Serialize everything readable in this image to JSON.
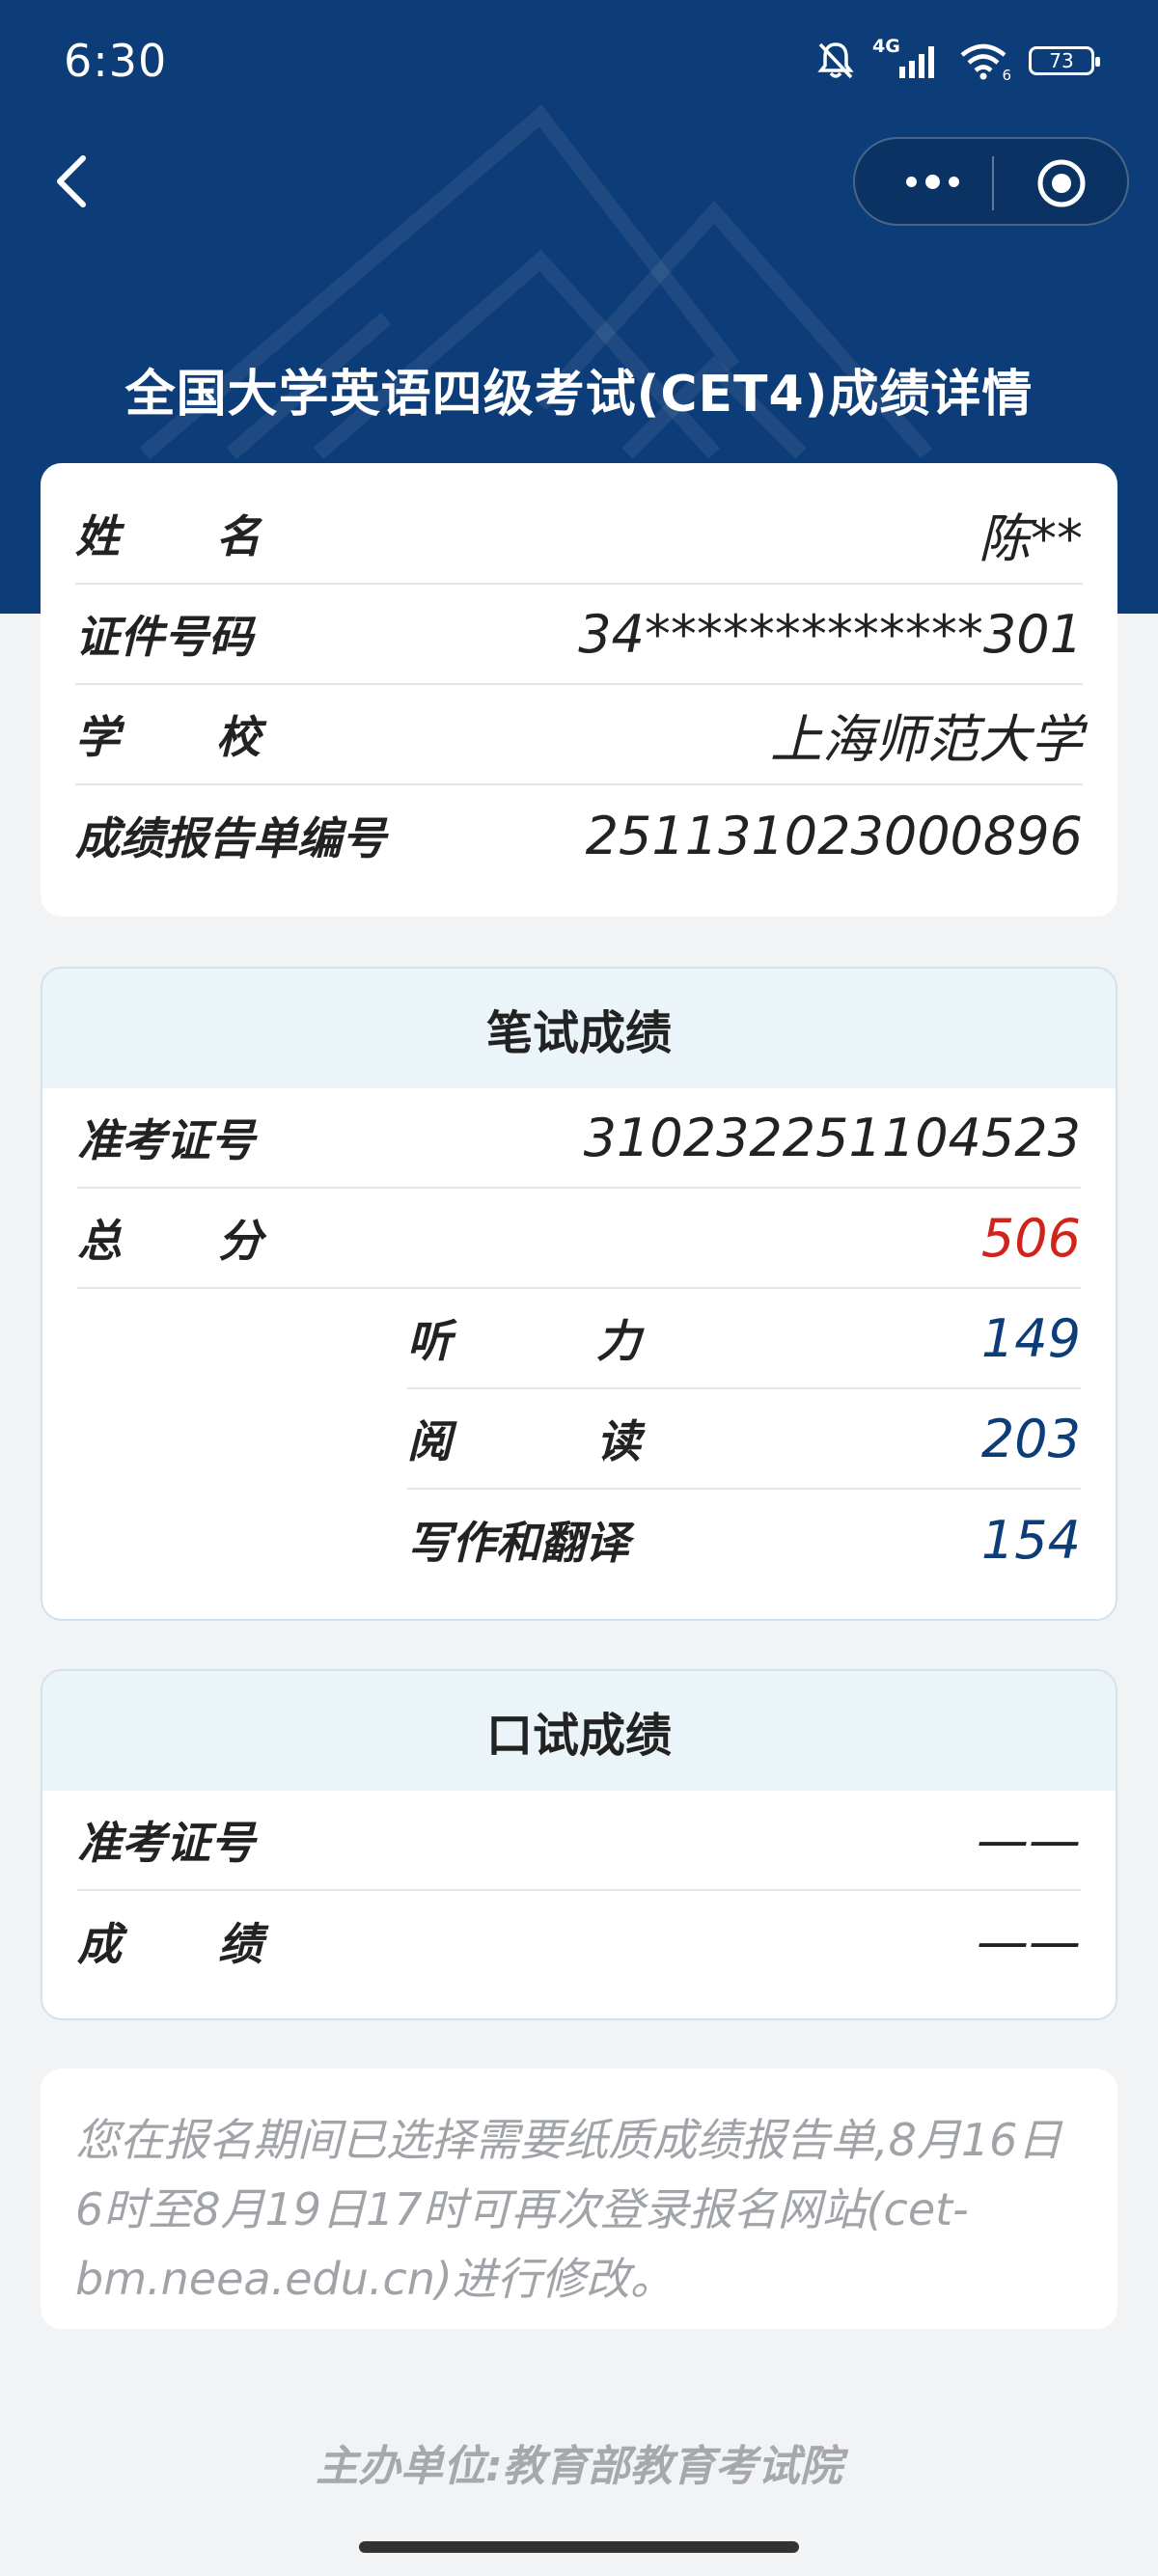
{
  "status_bar": {
    "time": "6:30",
    "network": "4G",
    "wifi_sub": "6",
    "battery": "73"
  },
  "header": {
    "title": "全国大学英语四级考试(CET4)成绩详情"
  },
  "personal_info": {
    "rows": [
      {
        "label": "姓名",
        "value": "陈**"
      },
      {
        "label": "证件号码",
        "value": "34*************301"
      },
      {
        "label": "学校",
        "value": "上海师范大学"
      },
      {
        "label": "成绩报告单编号",
        "value": "251131023000896"
      }
    ]
  },
  "written": {
    "title": "笔试成绩",
    "ticket_label": "准考证号",
    "ticket_value": "310232251104523",
    "total_label": "总分",
    "total_value": "506",
    "sections": [
      {
        "label": "听力",
        "value": "149"
      },
      {
        "label": "阅读",
        "value": "203"
      },
      {
        "label": "写作和翻译",
        "value": "154"
      }
    ]
  },
  "oral": {
    "title": "口试成绩",
    "ticket_label": "准考证号",
    "ticket_value": "——",
    "score_label": "成绩",
    "score_value": "——"
  },
  "notice": "您在报名期间已选择需要纸质成绩报告单,8月16日6时至8月19日17时可再次登录报名网站(cet-bm.neea.edu.cn)进行修改。",
  "footer": "主办单位:教育部教育考试院",
  "colors": {
    "header_bg": "#0d3d78",
    "total_score": "#d0231c",
    "section_score": "#0d3d78"
  }
}
